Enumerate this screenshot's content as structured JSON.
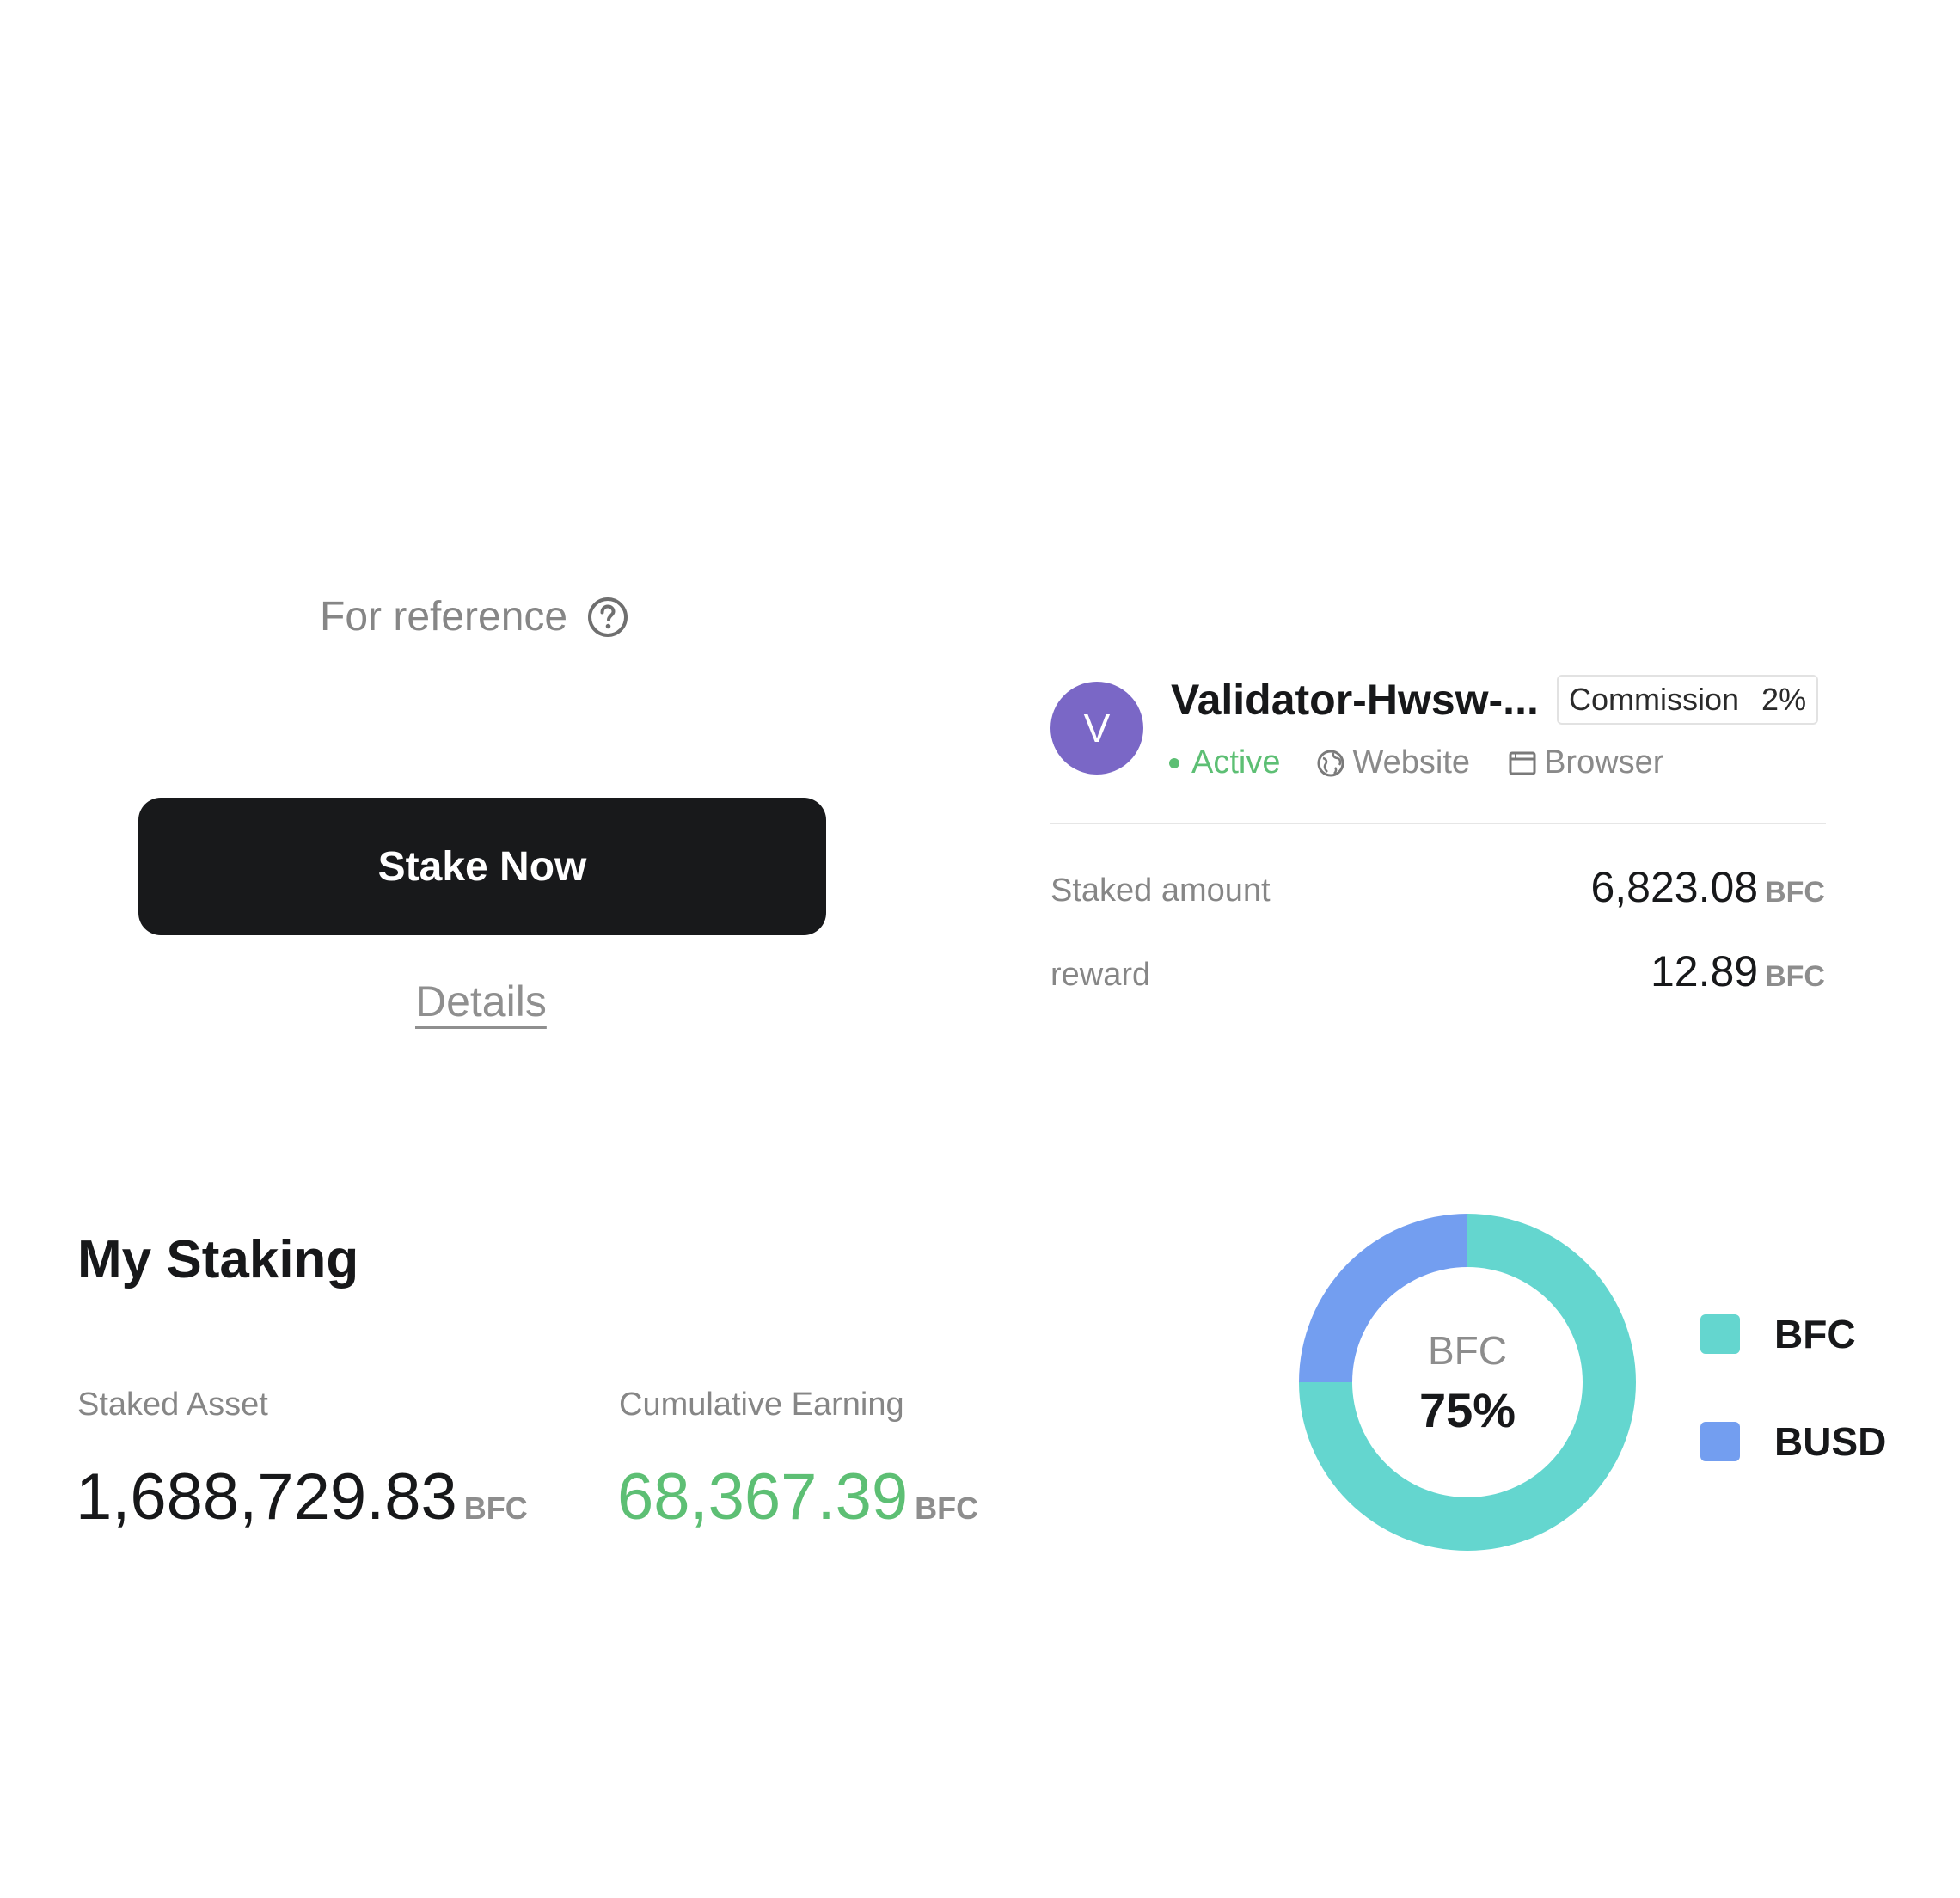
{
  "reference": {
    "label": "For reference"
  },
  "actions": {
    "stake_label": "Stake Now",
    "details_label": "Details"
  },
  "validator": {
    "avatar_letter": "V",
    "name": "Validator-Hwsw-...",
    "commission_label": "Commission",
    "commission_value": "2%",
    "status": "Active",
    "website_label": "Website",
    "browser_label": "Browser",
    "staked_amount_label": "Staked amount",
    "staked_amount_value": "6,823.08",
    "staked_amount_unit": "BFC",
    "reward_label": "reward",
    "reward_value": "12.89",
    "reward_unit": "BFC"
  },
  "my_staking": {
    "title": "My Staking",
    "staked_asset_label": "Staked Asset",
    "staked_asset_value": "1,688,729.83",
    "staked_asset_unit": "BFC",
    "cumulative_label": "Cumulative Earning",
    "cumulative_value": "68,367.39",
    "cumulative_unit": "BFC"
  },
  "colors": {
    "primary_button": "#18191b",
    "active_green": "#5dbf74",
    "earning_green": "#5dbf74",
    "avatar_purple": "#7a67c6",
    "bfc_teal": "#64d6cf",
    "busd_blue": "#739ef0"
  },
  "chart_data": {
    "type": "pie",
    "center_label": "BFC",
    "center_value": "75%",
    "slices": [
      {
        "name": "BFC",
        "value": 75,
        "color": "#64d6cf"
      },
      {
        "name": "BUSD",
        "value": 25,
        "color": "#739ef0"
      }
    ]
  }
}
